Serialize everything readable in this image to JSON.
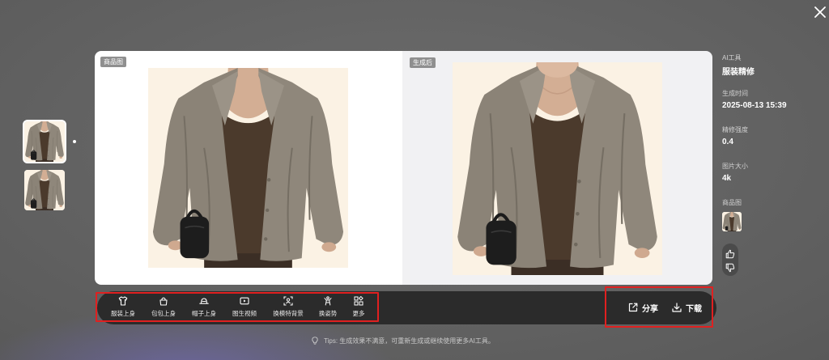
{
  "colors": {
    "background": "#626262",
    "toolbar": "#2b2b2b",
    "highlight_box": "#e02020",
    "badge": "#8f8f8f",
    "garment": "#8b8377"
  },
  "close": {
    "icon": "close-icon"
  },
  "history": {
    "selected_index": 0
  },
  "compare": {
    "before_label": "商品图",
    "after_label": "生成后"
  },
  "toolbar": {
    "tools": [
      {
        "label": "服装上身",
        "icon": "shirt-icon"
      },
      {
        "label": "包包上身",
        "icon": "bag-icon"
      },
      {
        "label": "帽子上身",
        "icon": "hat-icon"
      },
      {
        "label": "图生视频",
        "icon": "video-icon"
      },
      {
        "label": "换模特背景",
        "icon": "model-background-icon"
      },
      {
        "label": "换姿势",
        "icon": "pose-icon"
      },
      {
        "label": "更多",
        "icon": "more-grid-icon"
      }
    ],
    "share_label": "分享",
    "share_icon": "share-icon",
    "download_label": "下载",
    "download_icon": "download-icon"
  },
  "tips": {
    "text": "Tips: 生成效果不满意，可重新生成或继续使用更多AI工具。",
    "icon": "lightbulb-icon"
  },
  "info": {
    "tool": {
      "title": "AI工具",
      "value": "服装精修"
    },
    "time": {
      "title": "生成时间",
      "value": "2025-08-13 15:39"
    },
    "strength": {
      "title": "精修强度",
      "value": "0.4"
    },
    "size": {
      "title": "图片大小",
      "value": "4k"
    },
    "product": {
      "title": "商品图"
    },
    "feedback": {
      "like_icon": "thumbs-up-icon",
      "dislike_icon": "thumbs-down-icon"
    }
  }
}
